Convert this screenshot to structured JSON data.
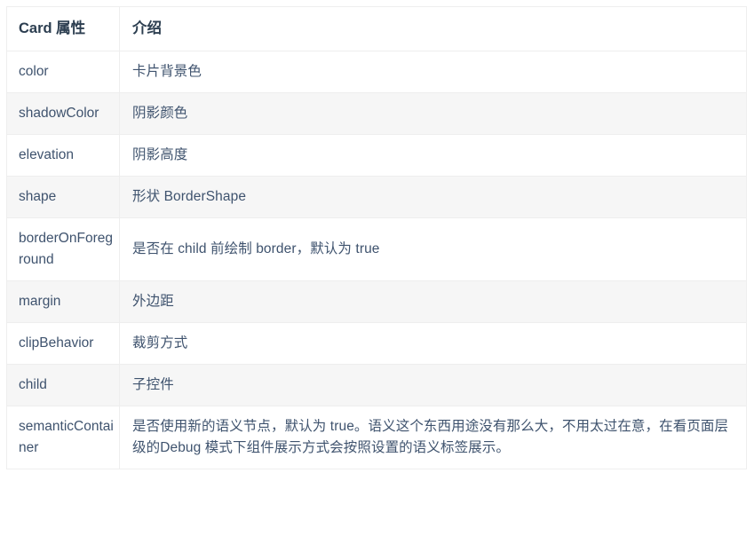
{
  "table": {
    "headers": {
      "name": "Card 属性",
      "description": "介绍"
    },
    "rows": [
      {
        "name": "color",
        "description": "卡片背景色"
      },
      {
        "name": "shadowColor",
        "description": "阴影颜色"
      },
      {
        "name": "elevation",
        "description": "阴影高度"
      },
      {
        "name": "shape",
        "description": "形状 BorderShape"
      },
      {
        "name": "borderOnForeground",
        "description": "是否在 child 前绘制 border，默认为 true"
      },
      {
        "name": "margin",
        "description": "外边距"
      },
      {
        "name": "clipBehavior",
        "description": "裁剪方式"
      },
      {
        "name": "child",
        "description": "子控件"
      },
      {
        "name": "semanticContainer",
        "description": "是否使用新的语义节点，默认为 true。语义这个东西用途没有那么大，不用太过在意，在看页面层级的Debug 模式下组件展示方式会按照设置的语义标签展示。"
      }
    ]
  },
  "colors": {
    "header_text": "#2c3e50",
    "body_text": "#3f536e",
    "row_stripe": "#f6f6f6",
    "row_base": "#ffffff",
    "border": "#eeeeee"
  }
}
